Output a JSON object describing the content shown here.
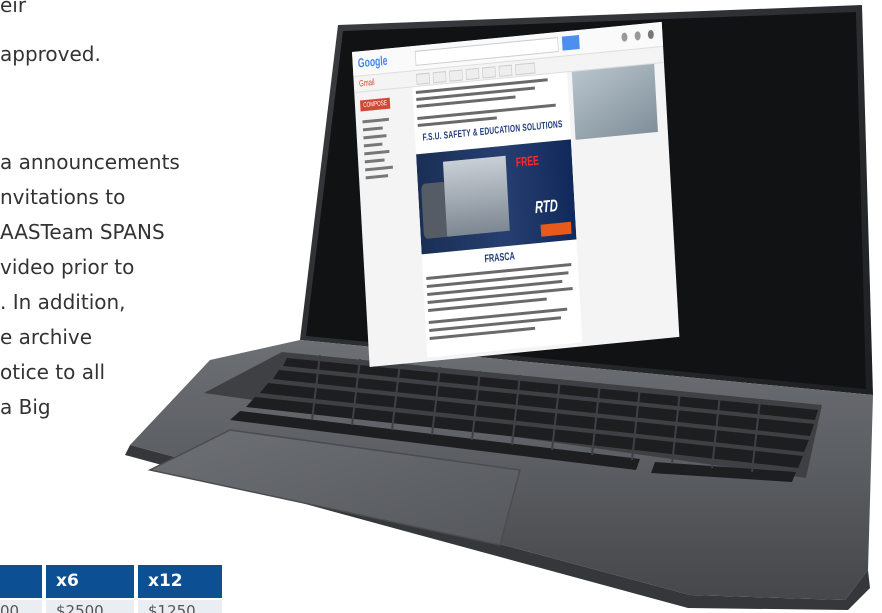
{
  "article": {
    "lines": [
      "eir",
      "approved.",
      "a announcements",
      "nvitations to",
      "AASTeam SPANS",
      "video prior to",
      ". In addition,",
      "e archive",
      "otice to all",
      "a Big"
    ]
  },
  "pricing": {
    "headers": [
      "x6",
      "x12"
    ],
    "values": [
      "00",
      "$2500",
      "$1250"
    ]
  },
  "laptop_screen": {
    "logo": "Google",
    "mail_label": "Gmail",
    "compose_label": "COMPOSE",
    "banner_title": "F.S.U. SAFETY & EDUCATION SOLUTIONS",
    "banner_headline": "FREE",
    "banner_brand": "RTD",
    "footer_brand": "FRASCA"
  },
  "colors": {
    "table_header": "#0d4f93",
    "table_cell": "#eaeef3",
    "laptop_body": "#5a5d61",
    "banner": "#1a2f55"
  }
}
